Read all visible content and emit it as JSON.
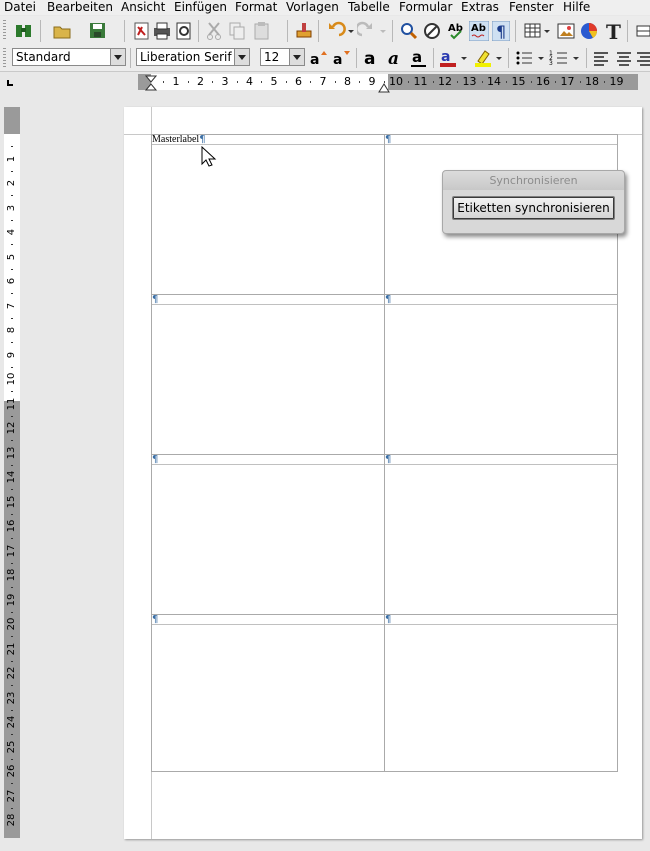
{
  "menubar": {
    "items": [
      {
        "label": "Datei"
      },
      {
        "label": "Bearbeiten"
      },
      {
        "label": "Ansicht"
      },
      {
        "label": "Einfügen"
      },
      {
        "label": "Format"
      },
      {
        "label": "Vorlagen"
      },
      {
        "label": "Tabelle"
      },
      {
        "label": "Formular"
      },
      {
        "label": "Extras"
      },
      {
        "label": "Fenster"
      },
      {
        "label": "Hilfe"
      }
    ]
  },
  "formatting": {
    "paragraph_style": "Standard",
    "font_name": "Liberation Serif",
    "font_size": "12"
  },
  "ruler": {
    "horizontal_numbers": [
      "1",
      "2",
      "3",
      "4",
      "5",
      "6",
      "7",
      "8",
      "9",
      "10",
      "11",
      "12",
      "13",
      "14",
      "15",
      "16",
      "17",
      "18",
      "19"
    ],
    "vertical_numbers": [
      "1",
      "2",
      "3",
      "4",
      "5",
      "6",
      "7",
      "8",
      "9",
      "10",
      "11",
      "12",
      "13",
      "14",
      "15",
      "16",
      "17",
      "18",
      "19",
      "20",
      "21",
      "22",
      "23",
      "24",
      "25",
      "26",
      "27",
      "28"
    ]
  },
  "document": {
    "labels": [
      {
        "text": "Masterlabel",
        "para_mark": "¶"
      },
      {
        "text": "",
        "para_mark": "¶"
      },
      {
        "text": "",
        "para_mark": "¶"
      },
      {
        "text": "",
        "para_mark": "¶"
      },
      {
        "text": "",
        "para_mark": "¶"
      },
      {
        "text": "",
        "para_mark": "¶"
      },
      {
        "text": "",
        "para_mark": "¶"
      },
      {
        "text": "",
        "para_mark": "¶"
      }
    ]
  },
  "sync_dialog": {
    "title": "Synchronisieren",
    "button_label": "Etiketten synchronisieren"
  },
  "colors": {
    "page": "#ffffff",
    "ruler_dim": "#9a9a9a",
    "toolbar": "#ececec",
    "para_mark": "#3a6ea5"
  }
}
